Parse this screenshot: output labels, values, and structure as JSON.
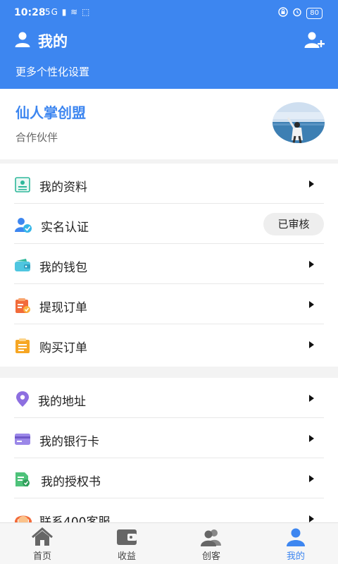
{
  "status_bar": {
    "time": "10:28",
    "left_icons": "5G ▮ ≋ ⬚",
    "battery": "80"
  },
  "header": {
    "title": "我的",
    "subtitle": "更多个性化设置"
  },
  "profile": {
    "name": "仙人掌创盟",
    "role": "合作伙伴"
  },
  "menu_group_1": [
    {
      "label": "我的资料",
      "icon": "profile-card-icon"
    },
    {
      "label": "实名认证",
      "icon": "verified-user-icon",
      "badge": "已审核"
    },
    {
      "label": "我的钱包",
      "icon": "wallet-icon"
    },
    {
      "label": "提现订单",
      "icon": "withdraw-clipboard-icon"
    },
    {
      "label": "购买订单",
      "icon": "purchase-clipboard-icon"
    }
  ],
  "menu_group_2": [
    {
      "label": "我的地址",
      "icon": "location-pin-icon"
    },
    {
      "label": "我的银行卡",
      "icon": "bank-card-icon"
    },
    {
      "label": "我的授权书",
      "icon": "authorization-doc-icon"
    },
    {
      "label": "联系400客服",
      "icon": "customer-service-icon"
    }
  ],
  "tabbar": [
    {
      "label": "首页",
      "icon": "home-icon"
    },
    {
      "label": "收益",
      "icon": "earnings-wallet-icon"
    },
    {
      "label": "创客",
      "icon": "makers-group-icon"
    },
    {
      "label": "我的",
      "icon": "me-user-icon",
      "active": true
    }
  ],
  "colors": {
    "accent": "#3d86f0",
    "badge_bg": "#eeeeee"
  }
}
